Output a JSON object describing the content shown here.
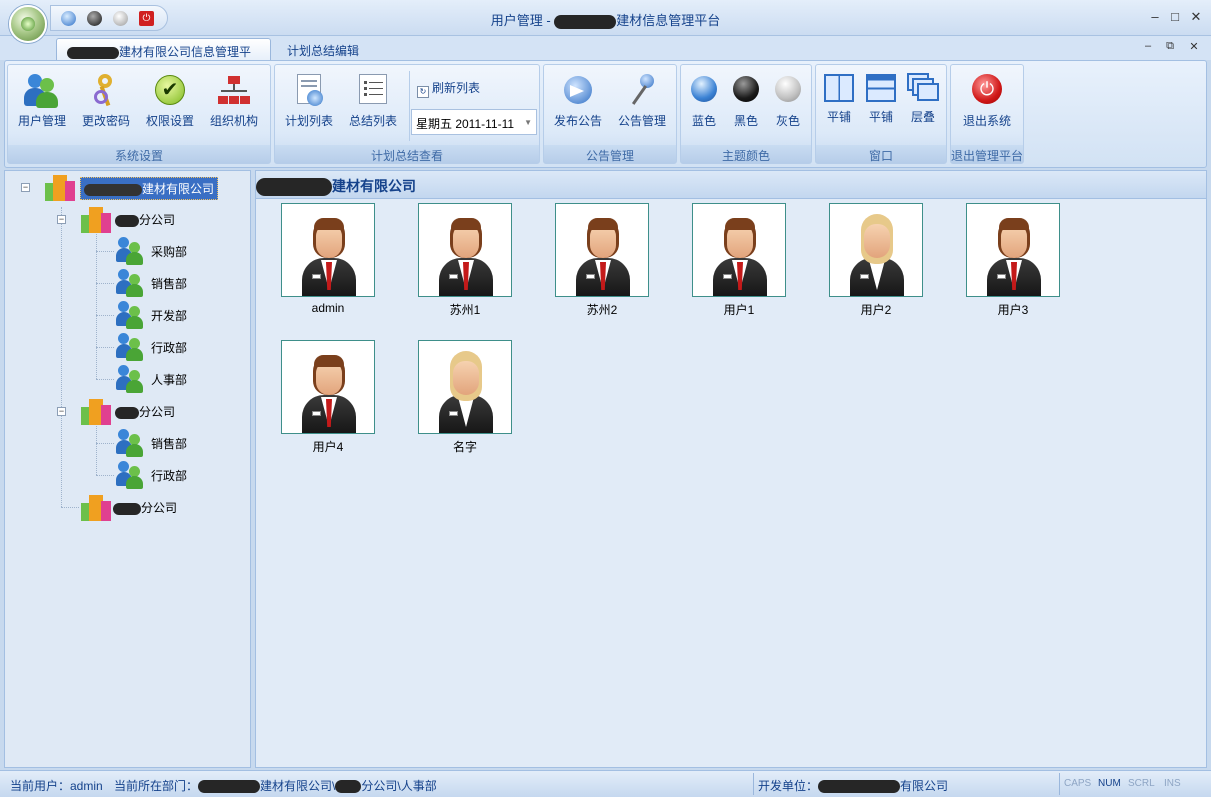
{
  "window": {
    "title_prefix": "用户管理 - ",
    "title_suffix": "建材信息管理平台",
    "controls": {
      "minimize": "–",
      "maximize": "□",
      "close": "✕"
    },
    "mdi_controls": {
      "minimize": "–",
      "restore": "⧉",
      "close": "✕"
    }
  },
  "tabs": [
    {
      "label": "建材有限公司信息管理平台",
      "active": true
    },
    {
      "label": "计划总结编辑",
      "active": false
    }
  ],
  "ribbon": {
    "groups": [
      {
        "label": "系统设置",
        "buttons": [
          {
            "label": "用户管理",
            "icon": "users-icon"
          },
          {
            "label": "更改密码",
            "icon": "key-icon"
          },
          {
            "label": "权限设置",
            "icon": "check-icon"
          },
          {
            "label": "组织机构",
            "icon": "org-chart-icon"
          }
        ]
      },
      {
        "label": "计划总结查看",
        "buttons": [
          {
            "label": "计划列表",
            "icon": "calendar-list-icon"
          },
          {
            "label": "总结列表",
            "icon": "list-icon"
          }
        ],
        "refresh_label": "刷新列表",
        "date_value": "星期五 2011-11-11"
      },
      {
        "label": "公告管理",
        "buttons": [
          {
            "label": "发布公告",
            "icon": "megaphone-icon"
          },
          {
            "label": "公告管理",
            "icon": "pushpin-icon"
          }
        ]
      },
      {
        "label": "主题颜色",
        "buttons": [
          {
            "label": "蓝色",
            "color": "#3b82d4"
          },
          {
            "label": "黑色",
            "color": "#1a1a1a"
          },
          {
            "label": "灰色",
            "color": "#a0a0a0"
          }
        ]
      },
      {
        "label": "窗口",
        "buttons": [
          {
            "label": "平铺",
            "icon": "tile-vertical-icon"
          },
          {
            "label": "平铺",
            "icon": "tile-horizontal-icon"
          },
          {
            "label": "层叠",
            "icon": "cascade-icon"
          }
        ]
      },
      {
        "label": "退出管理平台",
        "buttons": [
          {
            "label": "退出系统",
            "icon": "power-icon"
          }
        ]
      }
    ]
  },
  "tree": {
    "root": "建材有限公司",
    "branches": [
      {
        "label": "分公司",
        "departments": [
          "采购部",
          "销售部",
          "开发部",
          "行政部",
          "人事部"
        ]
      },
      {
        "label": "分公司",
        "departments": [
          "销售部",
          "行政部"
        ]
      },
      {
        "label": "分公司",
        "departments": []
      }
    ]
  },
  "content": {
    "header": "建材有限公司",
    "users": [
      {
        "name": "admin",
        "gender": "male"
      },
      {
        "name": "苏州1",
        "gender": "male"
      },
      {
        "name": "苏州2",
        "gender": "male"
      },
      {
        "name": "用户1",
        "gender": "male"
      },
      {
        "name": "用户2",
        "gender": "female"
      },
      {
        "name": "用户3",
        "gender": "male"
      },
      {
        "name": "用户4",
        "gender": "male"
      },
      {
        "name": "名字",
        "gender": "female"
      }
    ]
  },
  "status": {
    "current_user": "当前用户：admin",
    "dept_prefix": "当前所在部门：",
    "dept_mid": "建材有限公司\\",
    "dept_tail": "分公司\\人事部",
    "developer_prefix": "开发单位：",
    "developer_tail": "有限公司",
    "keys": [
      "CAPS",
      "NUM",
      "SCRL",
      "INS"
    ]
  }
}
